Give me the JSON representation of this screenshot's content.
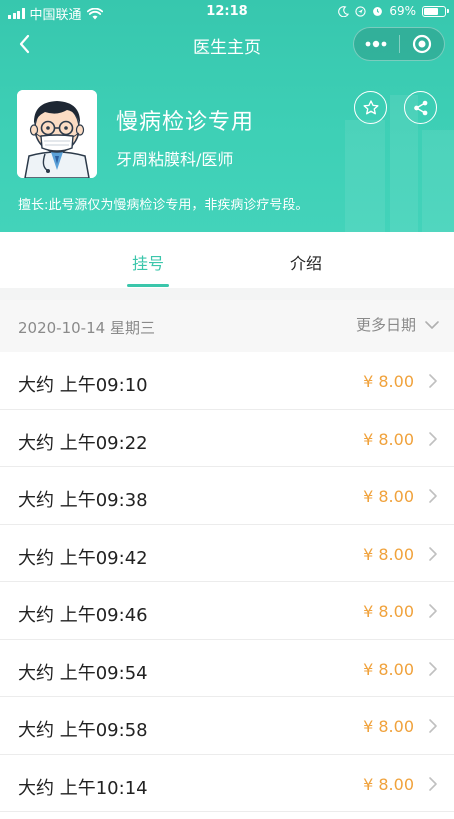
{
  "status_bar": {
    "carrier": "中国联通",
    "time": "12:18",
    "battery": "69%",
    "battery_level": 0.69
  },
  "nav": {
    "title": "医生主页",
    "back_icon": "chevron-left-icon",
    "more_icon": "more-dots-icon",
    "close_icon": "target-icon"
  },
  "doctor": {
    "name": "慢病检诊专用",
    "dept": "牙周粘膜科/医师",
    "speciality": "擅长:此号源仅为慢病检诊专用，非疾病诊疗号段。",
    "favorite_icon": "star-icon",
    "share_icon": "share-icon"
  },
  "tabs": [
    {
      "label": "挂号",
      "active": true
    },
    {
      "label": "介绍",
      "active": false
    }
  ],
  "date_row": {
    "date": "2020-10-14 星期三",
    "more": "更多日期"
  },
  "slots": [
    {
      "label": "大约 上午09:10",
      "price": "¥ 8.00"
    },
    {
      "label": "大约 上午09:22",
      "price": "¥ 8.00"
    },
    {
      "label": "大约 上午09:38",
      "price": "¥ 8.00"
    },
    {
      "label": "大约 上午09:42",
      "price": "¥ 8.00"
    },
    {
      "label": "大约 上午09:46",
      "price": "¥ 8.00"
    },
    {
      "label": "大约 上午09:54",
      "price": "¥ 8.00"
    },
    {
      "label": "大约 上午09:58",
      "price": "¥ 8.00"
    },
    {
      "label": "大约 上午10:14",
      "price": "¥ 8.00"
    }
  ],
  "colors": {
    "header": "#3ecdb4",
    "accent": "#3bc6ab",
    "price": "#f0a23c"
  }
}
